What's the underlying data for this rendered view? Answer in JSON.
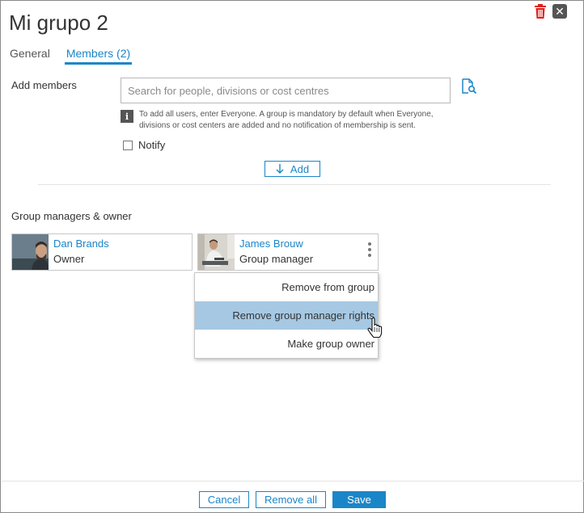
{
  "dialog": {
    "title": "Mi grupo 2"
  },
  "tabs": [
    {
      "label": "General",
      "active": false
    },
    {
      "label": "Members (2)",
      "active": true
    }
  ],
  "add_members": {
    "label": "Add members",
    "search_placeholder": "Search for people, divisions or cost centres",
    "search_value": "",
    "info_text": "To add all users, enter Everyone. A group is mandatory by default when Everyone, divisions or cost centers are added and no notification of membership is sent.",
    "notify_label": "Notify",
    "notify_checked": false,
    "add_button_label": "Add"
  },
  "managers": {
    "label": "Group managers & owner",
    "cards": [
      {
        "name": "Dan Brands",
        "role": "Owner"
      },
      {
        "name": "James Brouw",
        "role": "Group manager"
      }
    ]
  },
  "context_menu": {
    "items": [
      {
        "label": "Remove from group",
        "hovered": false
      },
      {
        "label": "Remove group manager rights",
        "hovered": true
      },
      {
        "label": "Make group owner",
        "hovered": false
      }
    ]
  },
  "footer": {
    "cancel_label": "Cancel",
    "remove_all_label": "Remove all",
    "save_label": "Save"
  },
  "colors": {
    "accent": "#1a86c8",
    "menu_hover": "#a6c8e2",
    "delete_red": "#e0201c"
  },
  "icons": {
    "delete": "trash-icon",
    "close": "close-icon",
    "lookup": "document-search-icon",
    "info": "info-icon",
    "add": "arrow-down-icon",
    "more": "more-vertical-icon",
    "cursor": "hand-pointer-icon"
  }
}
